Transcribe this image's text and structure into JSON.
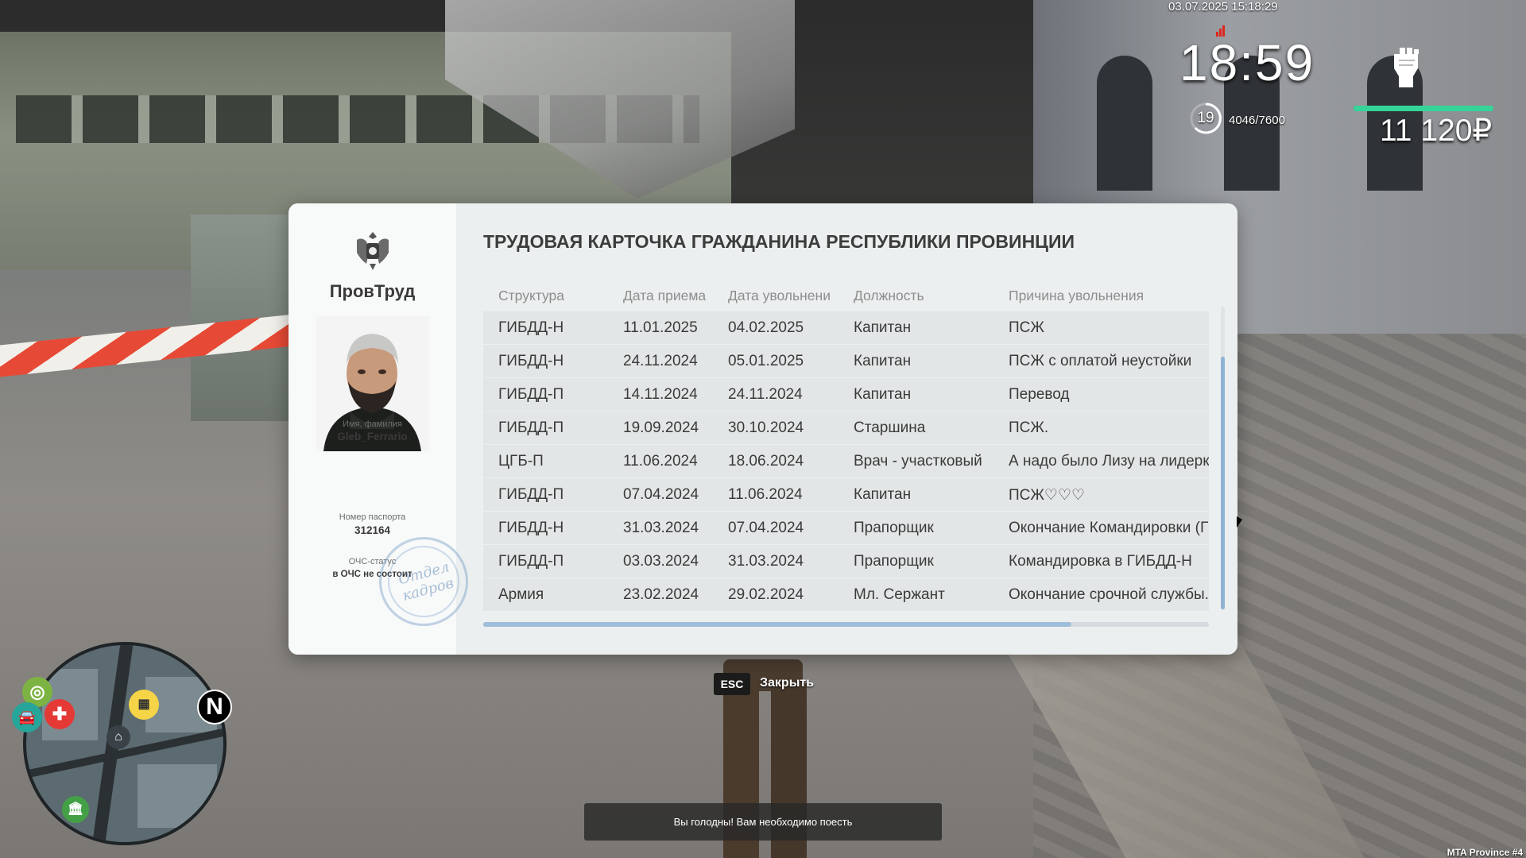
{
  "hud": {
    "datetime": "03.07.2025 15:18:29",
    "clock": "18:59",
    "level": "19",
    "xp": "4046/7600",
    "money": "11 120₽",
    "health_percent": 100,
    "health_color": "#35d49a"
  },
  "card": {
    "ministry": "ПровТруд",
    "title": "ТРУДОВАЯ КАРТОЧКА ГРАЖДАНИНА РЕСПУБЛИКИ ПРОВИНЦИИ",
    "name_label": "Имя, фамилия",
    "name": "Gleb_Ferrario",
    "passport_label": "Номер паспорта",
    "passport": "312164",
    "status_label": "ОЧС-статус",
    "status": "в ОЧС не состоит",
    "stamp_line1": "Отдел",
    "stamp_line2": "кадров",
    "columns": [
      "Структура",
      "Дата приема",
      "Дата увольнени",
      "Должность",
      "Причина увольнения"
    ],
    "rows": [
      [
        "ГИБДД-Н",
        "11.01.2025",
        "04.02.2025",
        "Капитан",
        "ПСЖ"
      ],
      [
        "ГИБДД-Н",
        "24.11.2024",
        "05.01.2025",
        "Капитан",
        "ПСЖ с оплатой неустойки"
      ],
      [
        "ГИБДД-П",
        "14.11.2024",
        "24.11.2024",
        "Капитан",
        "Перевод"
      ],
      [
        "ГИБДД-П",
        "19.09.2024",
        "30.10.2024",
        "Старшина",
        "ПСЖ."
      ],
      [
        "ЦГБ-П",
        "11.06.2024",
        "18.06.2024",
        "Врач - участковый",
        "А надо было Лизу на лидерку"
      ],
      [
        "ГИБДД-П",
        "07.04.2024",
        "11.06.2024",
        "Капитан",
        "ПСЖ♡♡♡"
      ],
      [
        "ГИБДД-Н",
        "31.03.2024",
        "07.04.2024",
        "Прапорщик",
        "Окончание Командировки (ГИБДД-П)"
      ],
      [
        "ГИБДД-П",
        "03.03.2024",
        "31.03.2024",
        "Прапорщик",
        "Командировка в ГИБДД-Н"
      ],
      [
        "Армия",
        "23.02.2024",
        "29.02.2024",
        "Мл. Сержант",
        "Окончание срочной службы."
      ]
    ]
  },
  "controls": {
    "esc_key": "ESC",
    "close_label": "Закрыть"
  },
  "notification": "Вы голодны! Вам необходимо поесть",
  "minimap": {
    "compass": "N",
    "markers": [
      "target-icon",
      "hospital-icon",
      "car-icon",
      "taxi-icon",
      "home-icon",
      "bank-icon"
    ]
  },
  "watermark": "MTA Province #4",
  "colors": {
    "accent": "#8fb3d3",
    "card_bg": "#ecefef",
    "row_bg": "#e3e6e6"
  }
}
